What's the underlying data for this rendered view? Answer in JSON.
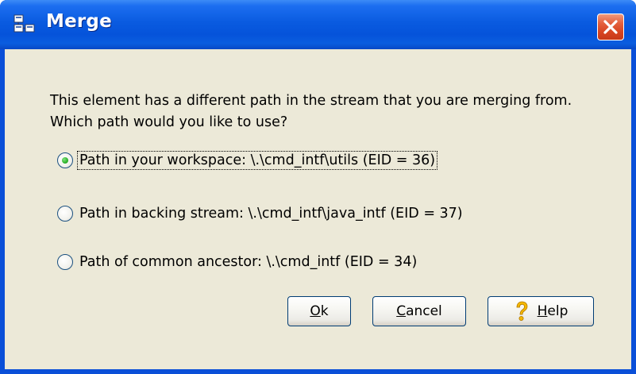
{
  "window": {
    "title": "Merge",
    "close_label": "Close"
  },
  "message": {
    "line1": "This element has a different path in the stream that you are merging from.",
    "line2": "Which path would you like to use?"
  },
  "options": [
    {
      "label": "Path in your workspace: \\.\\cmd_intf\\utils (EID = 36)",
      "selected": true
    },
    {
      "label": "Path in backing stream: \\.\\cmd_intf\\java_intf (EID = 37)",
      "selected": false
    },
    {
      "label": "Path of common ancestor: \\.\\cmd_intf (EID = 34)",
      "selected": false
    }
  ],
  "buttons": {
    "ok": {
      "mnemonic": "O",
      "rest": "k"
    },
    "cancel": {
      "mnemonic": "C",
      "rest": "ancel"
    },
    "help": {
      "mnemonic": "H",
      "rest": "elp"
    }
  },
  "colors": {
    "title_bar": "#0a5be0",
    "client_bg": "#ece9d8",
    "close_button": "#d74421",
    "radio_selected": "#2fb32c"
  },
  "icons": {
    "app": "merge-app-icon",
    "close": "close-icon",
    "help": "help-question-icon"
  }
}
